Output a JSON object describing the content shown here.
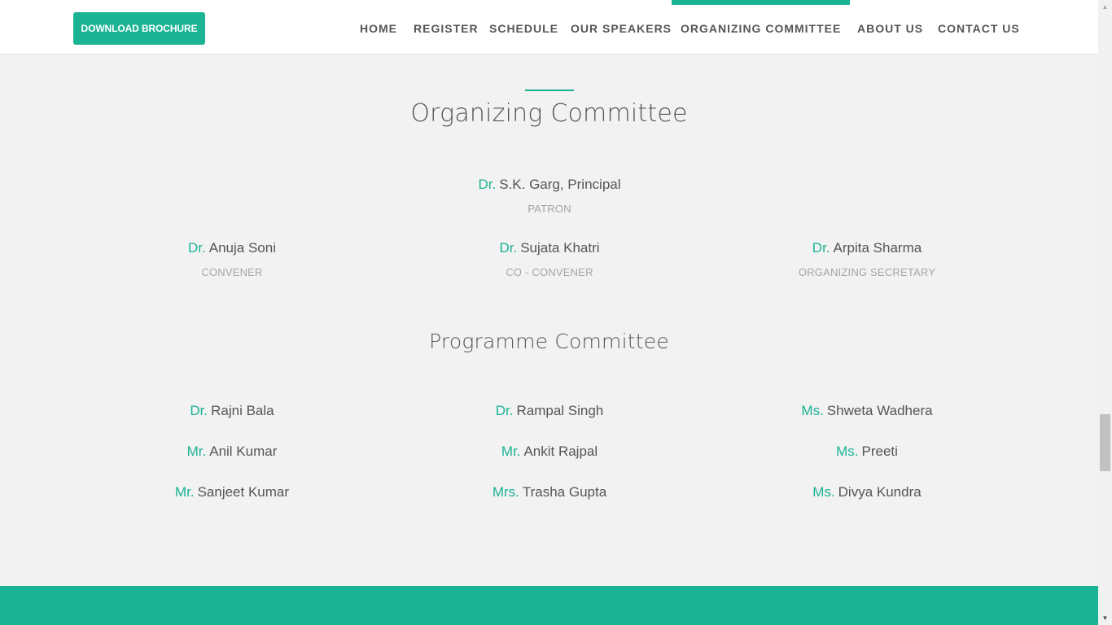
{
  "header": {
    "brochure_label": "DOWNLOAD BROCHURE",
    "nav": [
      {
        "label": "HOME",
        "active": false
      },
      {
        "label": "REGISTER",
        "active": false
      },
      {
        "label": "SCHEDULE",
        "active": false
      },
      {
        "label": "OUR SPEAKERS",
        "active": false
      },
      {
        "label": "ORGANIZING COMMITTEE",
        "active": true
      },
      {
        "label": "ABOUT US",
        "active": false
      },
      {
        "label": "CONTACT US",
        "active": false
      }
    ]
  },
  "organizing": {
    "title": "Organizing Committee",
    "patron": {
      "honorific": "Dr.",
      "name": "S.K. Garg, Principal",
      "role": "PATRON"
    },
    "members": [
      {
        "honorific": "Dr.",
        "name": "Anuja Soni",
        "role": "CONVENER"
      },
      {
        "honorific": "Dr.",
        "name": "Sujata Khatri",
        "role": "CO - CONVENER"
      },
      {
        "honorific": "Dr.",
        "name": "Arpita Sharma",
        "role": "ORGANIZING SECRETARY"
      }
    ]
  },
  "programme": {
    "title": "Programme Committee",
    "members": [
      {
        "honorific": "Dr.",
        "name": "Rajni Bala"
      },
      {
        "honorific": "Dr.",
        "name": "Rampal Singh"
      },
      {
        "honorific": "Ms.",
        "name": "Shweta Wadhera"
      },
      {
        "honorific": "Mr.",
        "name": "Anil Kumar"
      },
      {
        "honorific": "Mr.",
        "name": "Ankit Rajpal"
      },
      {
        "honorific": "Ms.",
        "name": "Preeti"
      },
      {
        "honorific": "Mr.",
        "name": "Sanjeet Kumar"
      },
      {
        "honorific": "Mrs.",
        "name": "Trasha Gupta"
      },
      {
        "honorific": "Ms.",
        "name": "Divya Kundra"
      }
    ]
  },
  "colors": {
    "accent": "#1ab394",
    "text": "#555555",
    "muted": "#a5a5a5",
    "background": "#f2f2f2"
  }
}
